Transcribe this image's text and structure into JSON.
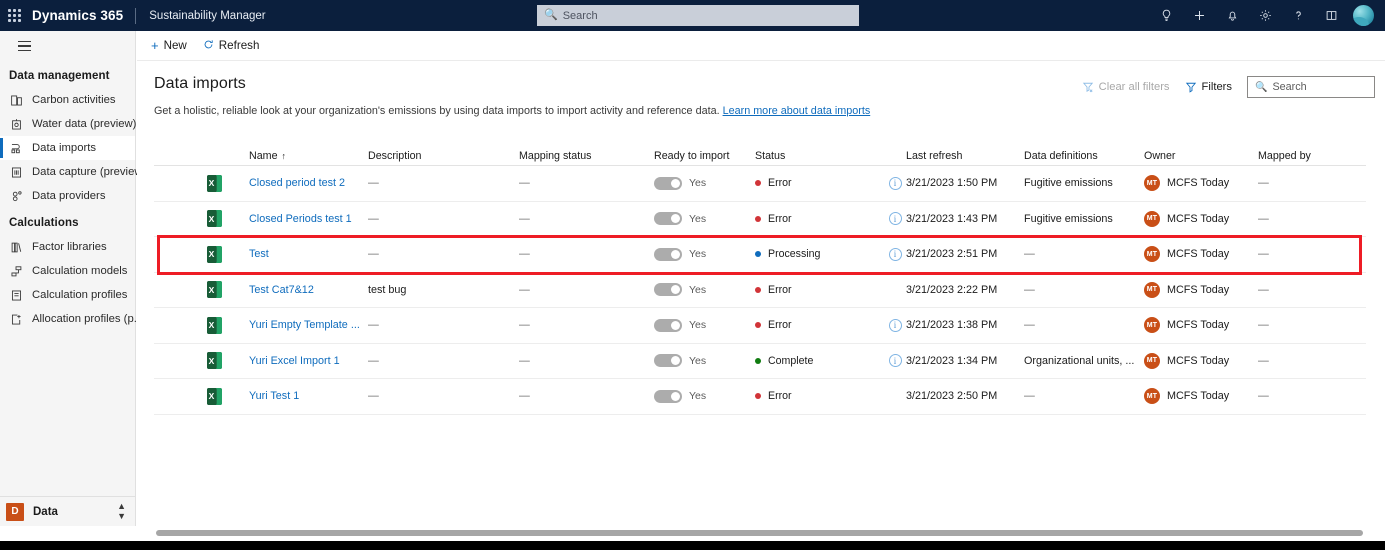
{
  "topbar": {
    "waffle_icon": "app-launcher-icon",
    "brand": "Dynamics 365",
    "app_name": "Sustainability Manager",
    "search_placeholder": "Search",
    "search_icon": "search-icon",
    "icons": [
      {
        "name": "lightbulb-icon",
        "glyph": "lightbulb"
      },
      {
        "name": "plus-icon",
        "glyph": "plus"
      },
      {
        "name": "bell-icon",
        "glyph": "bell"
      },
      {
        "name": "gear-icon",
        "glyph": "gear"
      },
      {
        "name": "help-icon",
        "glyph": "question"
      },
      {
        "name": "book-icon",
        "glyph": "book"
      }
    ],
    "avatar_name": "user-avatar"
  },
  "sidebar": {
    "hamburger_label": "site-map-toggle",
    "sections": [
      {
        "title": "Data management",
        "items": [
          {
            "label": "Carbon activities",
            "icon": "carbon-activities-icon",
            "active": false
          },
          {
            "label": "Water data (preview)",
            "icon": "water-data-icon",
            "active": false
          },
          {
            "label": "Data imports",
            "icon": "data-imports-icon",
            "active": true
          },
          {
            "label": "Data capture (preview)",
            "icon": "data-capture-icon",
            "active": false
          },
          {
            "label": "Data providers",
            "icon": "data-providers-icon",
            "active": false
          }
        ]
      },
      {
        "title": "Calculations",
        "items": [
          {
            "label": "Factor libraries",
            "icon": "factor-libraries-icon",
            "active": false
          },
          {
            "label": "Calculation models",
            "icon": "calculation-models-icon",
            "active": false
          },
          {
            "label": "Calculation profiles",
            "icon": "calculation-profiles-icon",
            "active": false
          },
          {
            "label": "Allocation profiles (p...",
            "icon": "allocation-profiles-icon",
            "active": false
          }
        ]
      }
    ],
    "area_switcher": {
      "badge": "D",
      "label": "Data",
      "chevron_icon": "chevron-updown-icon"
    }
  },
  "commandbar": {
    "new_label": "New",
    "new_icon": "plus-icon",
    "refresh_label": "Refresh",
    "refresh_icon": "refresh-icon"
  },
  "page": {
    "title": "Data imports",
    "subtitle": "Get a holistic, reliable look at your organization's emissions by using data imports to import activity and reference data.",
    "link_text": "Learn more about data imports"
  },
  "toolbar": {
    "clear_filters_label": "Clear all filters",
    "clear_filters_icon": "clear-filter-icon",
    "filters_label": "Filters",
    "filters_icon": "filter-icon",
    "search_placeholder": "Search",
    "search_icon": "search-icon"
  },
  "grid": {
    "columns": [
      "Name",
      "Description",
      "Mapping status",
      "Ready to import",
      "Status",
      "Last refresh",
      "Data definitions",
      "Owner",
      "Mapped by"
    ],
    "sort_column": "Name",
    "sort_indicator": "↑",
    "toggle_yes_label": "Yes",
    "dash": "—",
    "status_colors": {
      "Error": "#d13438",
      "Processing": "#0f6cbd",
      "Complete": "#107c10"
    },
    "rows": [
      {
        "file_icon": "excel-file-icon",
        "name": "Closed period test 2",
        "description": "—",
        "mapping_status": "—",
        "ready_to_import": "Yes",
        "status": "Error",
        "has_info": true,
        "last_refresh": "3/21/2023 1:50 PM",
        "data_definitions": "Fugitive emissions",
        "owner_initials": "MT",
        "owner": "MCFS Today",
        "mapped_by": "—",
        "highlighted": false
      },
      {
        "file_icon": "excel-file-icon",
        "name": "Closed Periods test 1",
        "description": "—",
        "mapping_status": "—",
        "ready_to_import": "Yes",
        "status": "Error",
        "has_info": true,
        "last_refresh": "3/21/2023 1:43 PM",
        "data_definitions": "Fugitive emissions",
        "owner_initials": "MT",
        "owner": "MCFS Today",
        "mapped_by": "—",
        "highlighted": false
      },
      {
        "file_icon": "excel-file-icon",
        "name": "Test",
        "description": "—",
        "mapping_status": "—",
        "ready_to_import": "Yes",
        "status": "Processing",
        "has_info": true,
        "last_refresh": "3/21/2023 2:51 PM",
        "data_definitions": "—",
        "owner_initials": "MT",
        "owner": "MCFS Today",
        "mapped_by": "—",
        "highlighted": true
      },
      {
        "file_icon": "excel-file-icon",
        "name": "Test Cat7&12",
        "description": "test bug",
        "mapping_status": "—",
        "ready_to_import": "Yes",
        "status": "Error",
        "has_info": false,
        "last_refresh": "3/21/2023 2:22 PM",
        "data_definitions": "—",
        "owner_initials": "MT",
        "owner": "MCFS Today",
        "mapped_by": "—",
        "highlighted": false
      },
      {
        "file_icon": "excel-file-icon",
        "name": "Yuri Empty Template ...",
        "description": "—",
        "mapping_status": "—",
        "ready_to_import": "Yes",
        "status": "Error",
        "has_info": true,
        "last_refresh": "3/21/2023 1:38 PM",
        "data_definitions": "—",
        "owner_initials": "MT",
        "owner": "MCFS Today",
        "mapped_by": "—",
        "highlighted": false
      },
      {
        "file_icon": "excel-file-icon",
        "name": "Yuri Excel Import 1",
        "description": "—",
        "mapping_status": "—",
        "ready_to_import": "Yes",
        "status": "Complete",
        "has_info": true,
        "last_refresh": "3/21/2023 1:34 PM",
        "data_definitions": "Organizational units, ...",
        "owner_initials": "MT",
        "owner": "MCFS Today",
        "mapped_by": "—",
        "highlighted": false
      },
      {
        "file_icon": "excel-file-icon",
        "name": "Yuri Test 1",
        "description": "—",
        "mapping_status": "—",
        "ready_to_import": "Yes",
        "status": "Error",
        "has_info": false,
        "last_refresh": "3/21/2023 2:50 PM",
        "data_definitions": "—",
        "owner_initials": "MT",
        "owner": "MCFS Today",
        "mapped_by": "—",
        "highlighted": false
      }
    ]
  },
  "annotation": {
    "highlight_color": "#ee1c25",
    "target_row": "Test"
  }
}
